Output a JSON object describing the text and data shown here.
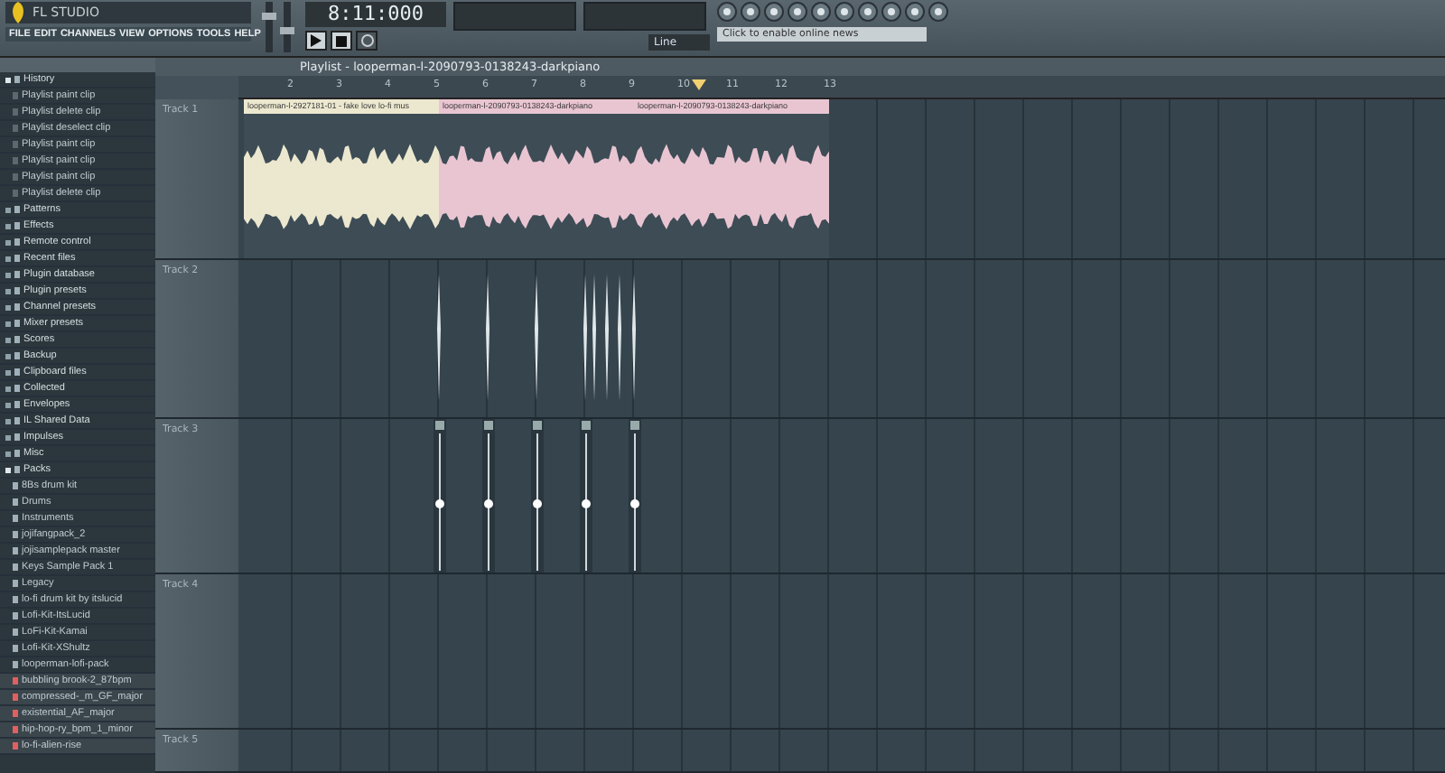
{
  "app": {
    "logo": "FL STUDIO",
    "menu": [
      "FILE",
      "EDIT",
      "CHANNELS",
      "VIEW",
      "OPTIONS",
      "TOOLS",
      "HELP"
    ],
    "time": "8:11:000",
    "mode": "Line",
    "news": "Click to enable online news"
  },
  "browser": {
    "items": [
      {
        "label": "History",
        "kind": "folder",
        "expanded": true,
        "children": [
          {
            "label": "Playlist paint clip",
            "kind": "action"
          },
          {
            "label": "Playlist delete clip",
            "kind": "action"
          },
          {
            "label": "Playlist deselect clip",
            "kind": "action"
          },
          {
            "label": "Playlist paint clip",
            "kind": "action"
          },
          {
            "label": "Playlist paint clip",
            "kind": "action"
          },
          {
            "label": "Playlist paint clip",
            "kind": "action"
          },
          {
            "label": "Playlist delete clip",
            "kind": "action"
          }
        ]
      },
      {
        "label": "Patterns",
        "kind": "folder",
        "expanded": false
      },
      {
        "label": "Effects",
        "kind": "folder",
        "expanded": false
      },
      {
        "label": "Remote control",
        "kind": "folder",
        "expanded": false
      },
      {
        "label": "Recent files",
        "kind": "folder",
        "expanded": false
      },
      {
        "label": "Plugin database",
        "kind": "folder",
        "expanded": false
      },
      {
        "label": "Plugin presets",
        "kind": "folder",
        "expanded": false
      },
      {
        "label": "Channel presets",
        "kind": "folder",
        "expanded": false
      },
      {
        "label": "Mixer presets",
        "kind": "folder",
        "expanded": false
      },
      {
        "label": "Scores",
        "kind": "folder",
        "expanded": false
      },
      {
        "label": "Backup",
        "kind": "folder",
        "expanded": false
      },
      {
        "label": "Clipboard files",
        "kind": "folder",
        "expanded": false
      },
      {
        "label": "Collected",
        "kind": "folder",
        "expanded": false
      },
      {
        "label": "Envelopes",
        "kind": "folder",
        "expanded": false
      },
      {
        "label": "IL Shared Data",
        "kind": "folder",
        "expanded": false
      },
      {
        "label": "Impulses",
        "kind": "folder",
        "expanded": false
      },
      {
        "label": "Misc",
        "kind": "folder",
        "expanded": false
      },
      {
        "label": "Packs",
        "kind": "folder",
        "expanded": true,
        "children": [
          {
            "label": "8Bs drum kit",
            "kind": "folder"
          },
          {
            "label": "Drums",
            "kind": "folder"
          },
          {
            "label": "Instruments",
            "kind": "folder"
          },
          {
            "label": "jojifangpack_2",
            "kind": "folder"
          },
          {
            "label": "jojisamplepack master",
            "kind": "folder"
          },
          {
            "label": "Keys Sample Pack 1",
            "kind": "folder"
          },
          {
            "label": "Legacy",
            "kind": "folder"
          },
          {
            "label": "lo-fi drum kit by itslucid",
            "kind": "folder"
          },
          {
            "label": "Lofi-Kit-ItsLucid",
            "kind": "folder"
          },
          {
            "label": "LoFi-Kit-Kamai",
            "kind": "folder"
          },
          {
            "label": "Lofi-Kit-XShultz",
            "kind": "folder"
          },
          {
            "label": "looperman-lofi-pack",
            "kind": "folder"
          },
          {
            "label": "bubbling brook-2_87bpm",
            "kind": "file"
          },
          {
            "label": "compressed-_m_GF_major",
            "kind": "file"
          },
          {
            "label": "existential_AF_major",
            "kind": "file"
          },
          {
            "label": "hip-hop-ry_bpm_1_minor",
            "kind": "file"
          },
          {
            "label": "lo-fi-alien-rise",
            "kind": "file"
          }
        ]
      }
    ]
  },
  "playlist": {
    "title": "Playlist - looperman-l-2090793-0138243-darkpiano",
    "ruler": [
      "2",
      "3",
      "4",
      "5",
      "6",
      "7",
      "8",
      "9",
      "10",
      "11",
      "12",
      "13"
    ],
    "tracks": [
      {
        "name": "Track 1",
        "clips": [
          {
            "label": "looperman-l-2927181-01 - fake love lo-fi mus",
            "color": "#ece8cf"
          },
          {
            "label": "looperman-l-2090793-0138243-darkpiano",
            "color": "#e9c5d2"
          },
          {
            "label": "looperman-l-2090793-0138243-darkpiano",
            "color": "#e9c5d2"
          }
        ]
      },
      {
        "name": "Track 2"
      },
      {
        "name": "Track 3"
      },
      {
        "name": "Track 4"
      },
      {
        "name": "Track 5"
      }
    ]
  }
}
